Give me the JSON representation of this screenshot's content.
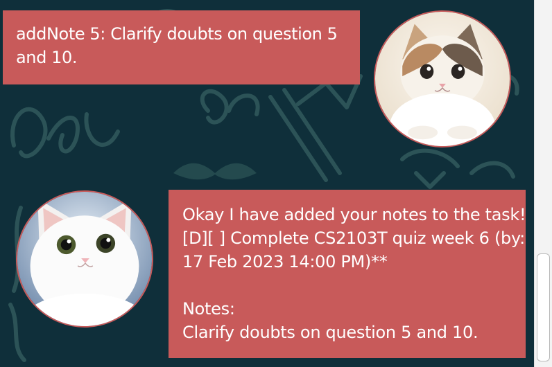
{
  "chat": {
    "user_message": {
      "lines": [
        "addNote 5: Clarify doubts on question 5",
        "and 10."
      ],
      "avatar": "cat-avatar-user"
    },
    "bot_message": {
      "lines": [
        "Okay I have added your notes to the task!",
        "[D][ ] Complete CS2103T quiz week 6 (by:",
        "17 Feb 2023 14:00 PM)**",
        "",
        "Notes:",
        "Clarify doubts on question 5 and 10."
      ],
      "avatar": "cat-avatar-bot"
    }
  },
  "colors": {
    "background": "#0f2f3a",
    "bubble": "#c85a5a",
    "bubble_text": "#ffffff",
    "scrollbar_track": "#f3f3f3"
  },
  "scrollbar": {
    "position_fraction": 1.0
  }
}
